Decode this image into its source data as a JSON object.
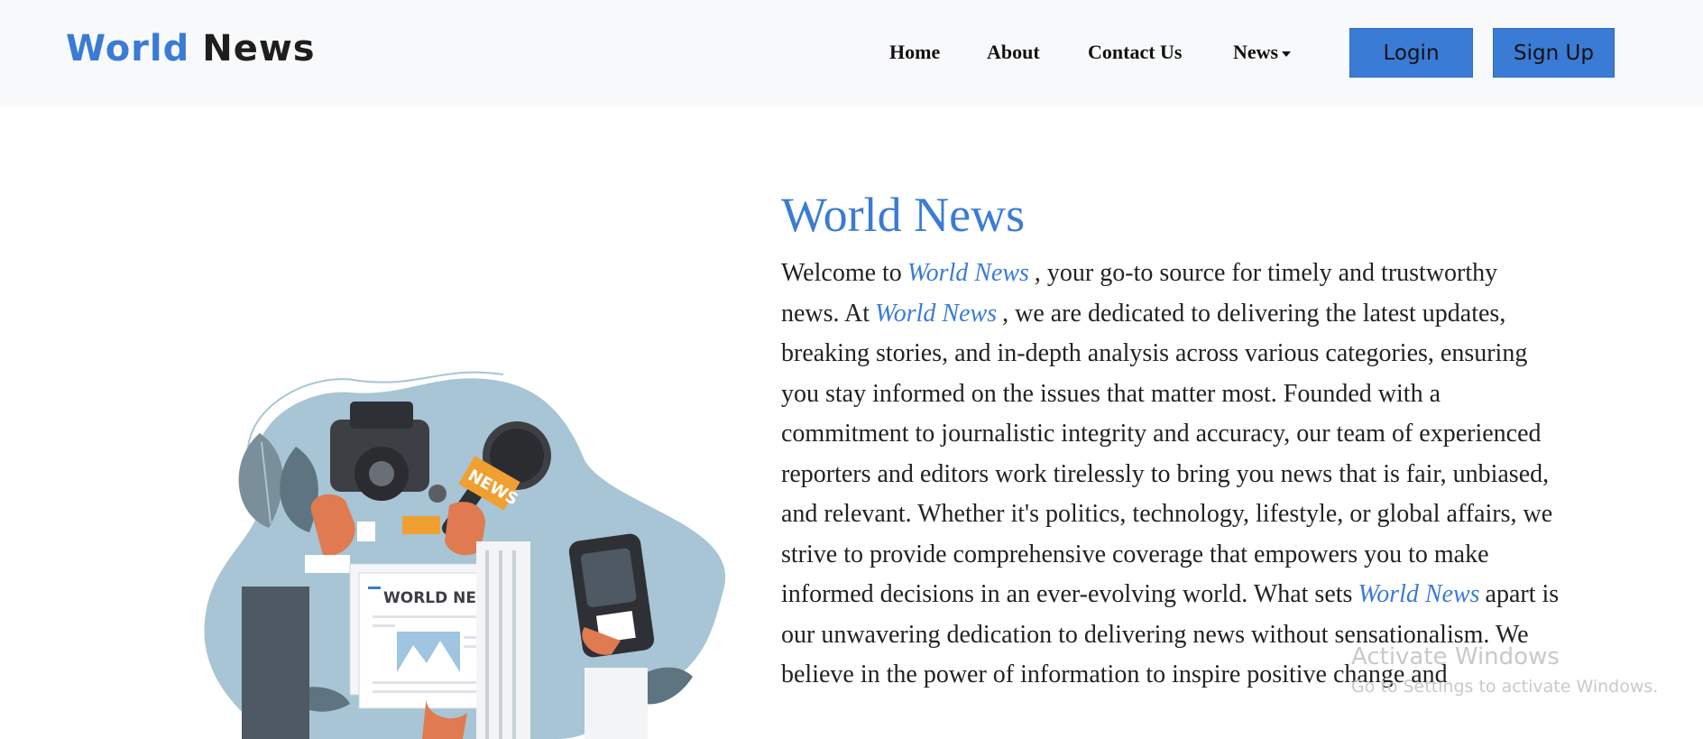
{
  "brand": {
    "part1": "World",
    "part2": "News"
  },
  "nav": {
    "home": "Home",
    "about": "About",
    "contact": "Contact Us",
    "news": "News"
  },
  "buttons": {
    "login": "Login",
    "signup": "Sign Up"
  },
  "colors": {
    "accent": "#3a7bd5",
    "navbar_bg": "#f8f9fa",
    "text": "#222222"
  },
  "hero": {
    "title": "World News",
    "p1": "Welcome to",
    "hl1": "World News",
    "p2": ", your go-to source for timely and trustworthy news. At",
    "hl2": "World News",
    "p3": ", we are dedicated to delivering the latest updates, breaking stories, and in-depth analysis across various categories, ensuring you stay informed on the issues that matter most. Founded with a commitment to journalistic integrity and accuracy, our team of experienced reporters and editors work tirelessly to bring you news that is fair, unbiased, and relevant. Whether it's politics, technology, lifestyle, or global affairs, we strive to provide comprehensive coverage that empowers you to make informed decisions in an ever-evolving world. What sets",
    "hl3": "World News",
    "p4": "apart is our unwavering dedication to delivering news without sensationalism. We believe in the power of information to inspire positive change and"
  },
  "illustration": {
    "newspaper_title": "WORLD NEWS",
    "mic_flag": "NEWS"
  },
  "watermark": {
    "line1": "Activate Windows",
    "line2": "Go to Settings to activate Windows."
  }
}
